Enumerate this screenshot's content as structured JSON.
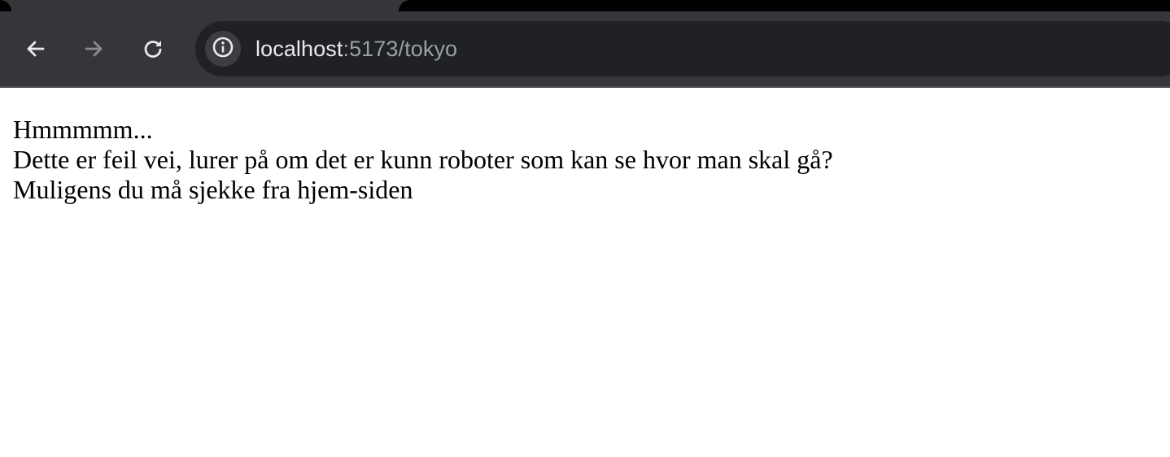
{
  "browser": {
    "url_host": "localhost",
    "url_rest": ":5173/tokyo",
    "icons": {
      "back": "arrow-left-icon",
      "forward": "arrow-right-icon",
      "reload": "reload-icon",
      "site_info": "info-icon"
    },
    "colors": {
      "chrome": "#35363a",
      "omnibox": "#202124",
      "url_host": "#e8eaed",
      "url_rest": "#9aa0a6"
    }
  },
  "page": {
    "lines": [
      "Hmmmmm...",
      "Dette er feil vei, lurer på om det er kunn roboter som kan se hvor man skal gå?",
      "Muligens du må sjekke fra hjem-siden"
    ]
  }
}
